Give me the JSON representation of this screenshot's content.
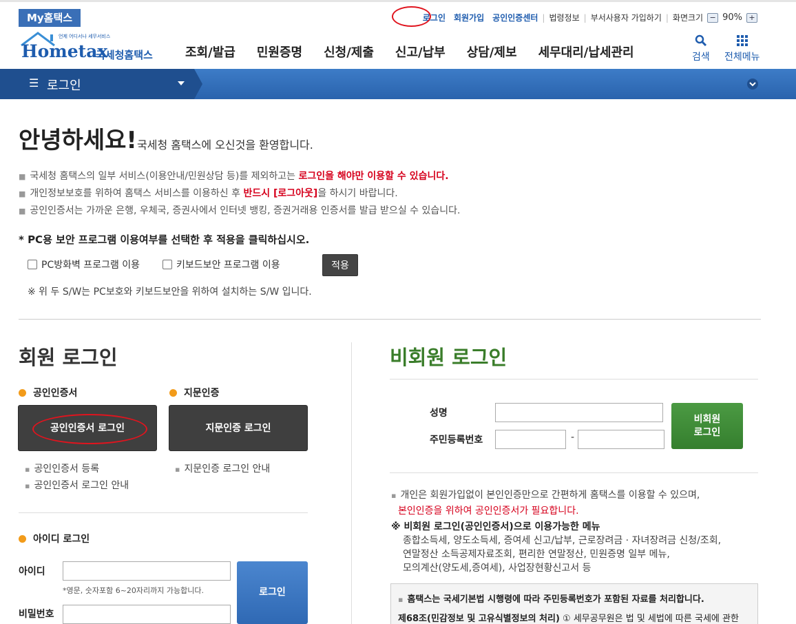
{
  "topbar": {
    "my_hometax": "My홈택스",
    "links": [
      "로그인",
      "회원가입",
      "공인인증센터",
      "법령정보",
      "부서사용자 가입하기",
      "화면크기"
    ],
    "zoom_minus": "−",
    "zoom_value": "90%",
    "zoom_plus": "+"
  },
  "header": {
    "logo_small": "언제 어디서나 세무서비스",
    "logo_main": "Hometax",
    "logo_sub": "국세청홈택스",
    "nav": [
      "조회/발급",
      "민원증명",
      "신청/제출",
      "신고/납부",
      "상담/제보",
      "세무대리/납세관리"
    ],
    "search_label": "검색",
    "allmenu_label": "전체메뉴"
  },
  "bluebar": {
    "label": "로그인"
  },
  "greeting": {
    "big": "안녕하세요!",
    "small": "국세청 홈택스에 오신것을 환영합니다.",
    "note1_a": "국세청 홈택스의 일부 서비스(이용안내/민원상담 등)를 제외하고는 ",
    "note1_b": "로그인을 해야만 이용할 수 있습니다.",
    "note2_a": "개인정보보호를 위하여 홈택스 서비스를 이용하신 후 ",
    "note2_b": "반드시 [로그아웃]",
    "note2_c": "을 하시기 바랍니다.",
    "note3": "공인인증서는 가까운 은행, 우체국, 증권사에서 인터넷 뱅킹, 증권거래용 인증서를 발급 받으실 수 있습니다."
  },
  "pc_security": {
    "title": "* PC용 보안 프로그램 이용여부를 선택한 후 적용을 클릭하십시오.",
    "firewall": "PC방화벽 프로그램 이용",
    "keyboard": "키보드보안 프로그램 이용",
    "apply": "적용",
    "note": "※ 위 두 S/W는 PC보호와 키보드보안을 위하여 설치하는 S/W 입니다."
  },
  "member": {
    "title": "회원 로그인",
    "cert_label": "공인인증서",
    "cert_button": "공인인증서 로그인",
    "finger_label": "지문인증",
    "finger_button": "지문인증 로그인",
    "cert_register": "공인인증서 등록",
    "cert_guide": "공인인증서 로그인 안내",
    "finger_guide": "지문인증 로그인 안내",
    "id_login_label": "아이디 로그인",
    "id_label": "아이디",
    "id_value": "",
    "id_hint": "*영문, 숫자포함 6~20자리까지 가능합니다.",
    "pw_label": "비밀번호",
    "pw_value": "",
    "login_button": "로그인"
  },
  "nonmember": {
    "title": "비회원 로그인",
    "name_label": "성명",
    "name_value": "",
    "rrn_label": "주민등록번호",
    "rrn1_value": "",
    "rrn_dash": "-",
    "rrn2_value": "",
    "button_line1": "비회원",
    "button_line2": "로그인",
    "info1": "개인은 회원가입없이 본인인증만으로 간편하게 홈택스를 이용할 수 있으며,",
    "info2": "본인인증을 위하여 공인인증서가 필요합니다.",
    "menu_title": "※ 비회원 로그인(공인인증서)으로 이용가능한 메뉴",
    "menu_line1": "종합소득세, 양도소득세, 증여세 신고/납부, 근로장려금 · 자녀장려금 신청/조회,",
    "menu_line2": "연말정산 소득공제자료조회, 편리한 연말정산, 민원증명 일부 메뉴,",
    "menu_line3": "모의계산(양도세,증여세), 사업장현황신고서 등",
    "box_line1": "홈택스는 국세기본법 시행령에 따라 주민등록번호가 포함된 자료를 처리합니다.",
    "box_line2_bold": "제68조(민감정보 및 고유식별정보의 처리)",
    "box_line2_rest": " ① 세무공무원은 법 및 세법에 따른 국세에 관한"
  },
  "colors": {
    "brand_blue": "#1e5cae",
    "alert_red": "#d6001c",
    "nonmember_green": "#3a7d2a",
    "accent_orange": "#f29b1a"
  }
}
